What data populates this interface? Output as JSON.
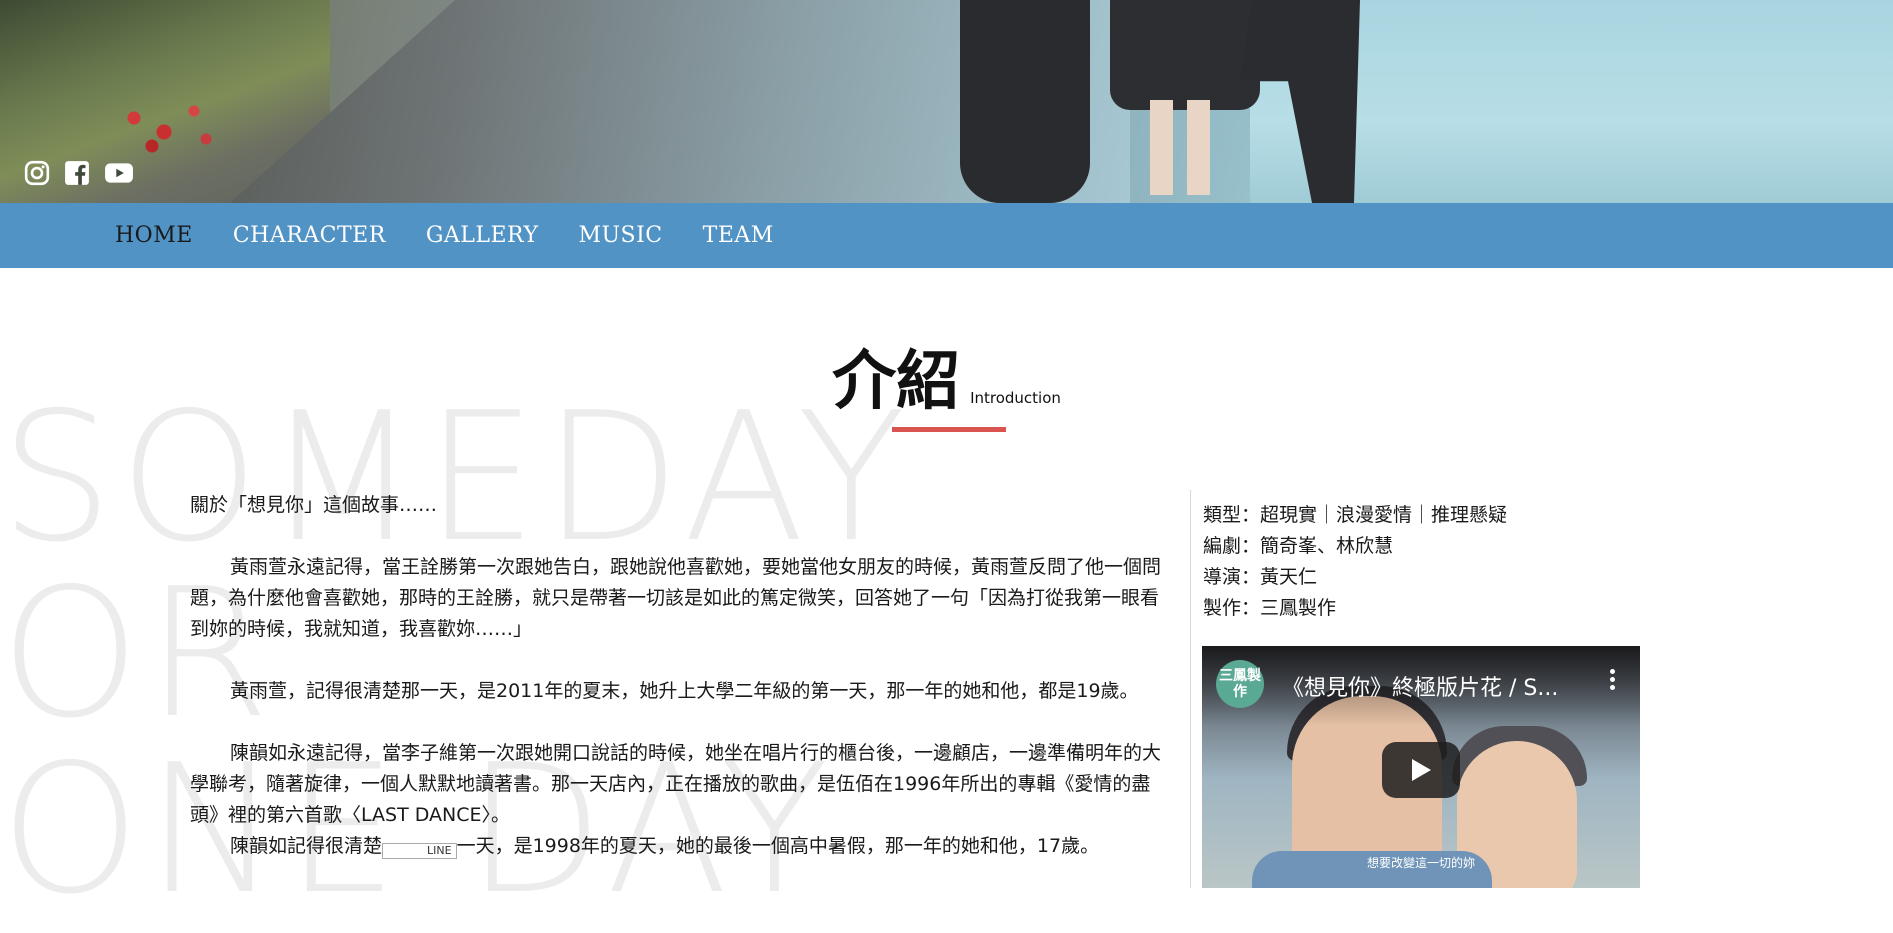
{
  "hero": {
    "social": [
      {
        "icon": "instagram-icon"
      },
      {
        "icon": "facebook-icon"
      },
      {
        "icon": "youtube-icon"
      }
    ]
  },
  "nav": {
    "items": [
      {
        "label": "HOME",
        "active": true
      },
      {
        "label": "CHARACTER",
        "active": false
      },
      {
        "label": "GALLERY",
        "active": false
      },
      {
        "label": "MUSIC",
        "active": false
      },
      {
        "label": "TEAM",
        "active": false
      }
    ]
  },
  "background_text": [
    "SOMEDAY",
    "OR",
    "ONE DAY"
  ],
  "section": {
    "title_zh": "介紹",
    "title_en": "Introduction",
    "accent_color": "#d9534f"
  },
  "article": {
    "lead": "關於「想見你」這個故事……",
    "p1": "黃雨萱永遠記得，當王詮勝第一次跟她告白，跟她說他喜歡她，要她當他女朋友的時候，黃雨萱反問了他一個問題，為什麼他會喜歡她，那時的王詮勝，就只是帶著一切該是如此的篤定微笑，回答她了一句「因為打從我第一眼看到妳的時候，我就知道，我喜歡妳……」",
    "p2": "黃雨萱，記得很清楚那一天，是2011年的夏末，她升上大學二年級的第一天，那一年的她和他，都是19歲。",
    "p3": "陳韻如永遠記得，當李子維第一次跟她開口說話的時候，她坐在唱片行的櫃台後，一邊顧店，一邊準備明年的大學聯考，隨著旋律，一個人默默地讀著書。那一天店內，正在播放的歌曲，是伍佰在1996年所出的專輯《愛情的盡頭》裡的第六首歌〈LAST DANCE〉。",
    "p4_before": "陳韻如記得很清楚",
    "p4_tag": "LINE",
    "p4_after": "一天，是1998年的夏天，她的最後一個高中暑假，那一年的她和他，17歲。"
  },
  "info": {
    "genre": "類型：超現實｜浪漫愛情｜推理懸疑",
    "writers": "編劇：簡奇峯、林欣慧",
    "director": "導演：黃天仁",
    "producer": "製作：三鳳製作"
  },
  "video": {
    "channel_logo": "三鳳製作",
    "title": "《想見你》終極版片花 / S...",
    "subtitle": "想要改變這一切的妳",
    "play_icon": "play-icon",
    "more_icon": "more-vertical-icon"
  },
  "colors": {
    "nav_bg": "#5193c5",
    "nav_active": "#1a1a1a",
    "nav_text": "#ffffff"
  }
}
